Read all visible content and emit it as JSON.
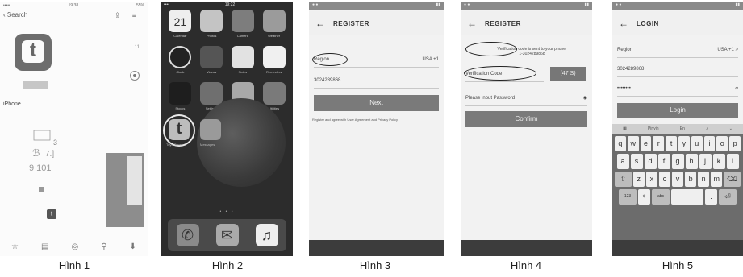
{
  "figures": [
    {
      "caption": "Hình 1",
      "status": {
        "left": "••••• ",
        "time": "19:38",
        "battery": "55%"
      },
      "back_label": "Search",
      "side_text": "11",
      "device_label": "iPhone",
      "tab_icons": [
        "star-icon",
        "apps-icon",
        "updates-icon",
        "search-icon",
        "download-icon"
      ]
    },
    {
      "caption": "Hình 2",
      "status": {
        "left": "••••",
        "time": "19:22",
        "battery": ""
      },
      "calendar": {
        "day": "Thursday",
        "date": "21"
      },
      "apps_row1": [
        "Calendar",
        "Photos",
        "Camera",
        "Weather"
      ],
      "apps_row2": [
        "Clock",
        "Videos",
        "Notes",
        "Reminders"
      ],
      "apps_row3": [
        "Stocks",
        "Settings",
        "Maps",
        "Utilities"
      ],
      "tuya_label": "Tuya Smart",
      "smart_label": "Messages",
      "dock": [
        "Phone",
        "Mail",
        "Music"
      ]
    },
    {
      "caption": "Hình 3",
      "title": "REGISTER",
      "region_label": "Region",
      "region_value": "USA +1",
      "phone_value": "3024289868",
      "next_label": "Next",
      "agreement": "Register and agree with User Agreement and Privacy Policy"
    },
    {
      "caption": "Hình 4",
      "title": "REGISTER",
      "sent_note": "Verification code is sent to your phone:",
      "sent_number": "1-3024289868",
      "code_placeholder": "Verification Code",
      "countdown": "(47 S)",
      "password_placeholder": "Please input Password",
      "confirm_label": "Confirm"
    },
    {
      "caption": "Hình 5",
      "title": "LOGIN",
      "region_label": "Region",
      "region_value": "USA +1 >",
      "phone_value": "3024289868",
      "password_mask": "••••••••",
      "login_label": "Login",
      "kb_suggest": [
        "Pinyin",
        "En"
      ],
      "kb_row1": [
        "q",
        "w",
        "e",
        "r",
        "t",
        "y",
        "u",
        "i",
        "o",
        "p"
      ],
      "kb_row2": [
        "a",
        "s",
        "d",
        "f",
        "g",
        "h",
        "j",
        "k",
        "l"
      ],
      "kb_row3": [
        "z",
        "x",
        "c",
        "v",
        "b",
        "n",
        "m"
      ],
      "kb_row4_left": "123",
      "kb_row4_mid": "abc"
    }
  ]
}
